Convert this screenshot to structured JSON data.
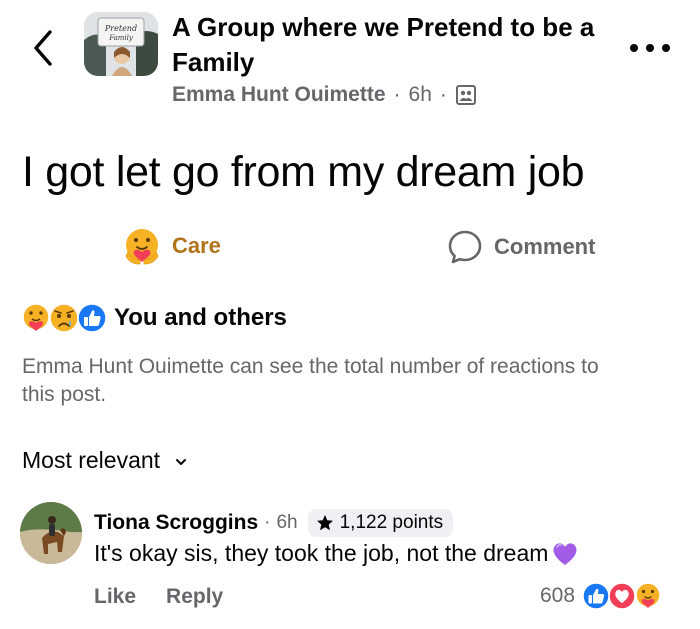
{
  "header": {
    "group_name": "A Group where we Pretend to be a Family",
    "group_avatar_text": "Pretend Family",
    "author": "Emma Hunt Ouimette",
    "time": "6h",
    "separator": "·"
  },
  "post": {
    "text": "I got let go from my dream job"
  },
  "actions": {
    "care_label": "Care",
    "comment_label": "Comment"
  },
  "reactions": {
    "summary_label": "You and others",
    "privacy_note": "Emma Hunt Ouimette can see the total number of reactions to this post.",
    "icons": [
      "care-emoji",
      "sad-emoji",
      "like-emoji"
    ]
  },
  "sort": {
    "label": "Most relevant"
  },
  "comment": {
    "author": "Tiona Scroggins",
    "separator": "·",
    "time": "6h",
    "points": "1,122 points",
    "text": "It's okay sis, they took the job, not the dream",
    "like_label": "Like",
    "reply_label": "Reply",
    "reaction_count": "608",
    "reaction_icons": [
      "like-emoji",
      "love-emoji",
      "care-emoji"
    ]
  },
  "colors": {
    "care_accent": "#b2731b",
    "secondary_text": "#65676b",
    "like_blue": "#1877f2",
    "love_red": "#f33e58",
    "badge_bg": "#eef0f3"
  }
}
